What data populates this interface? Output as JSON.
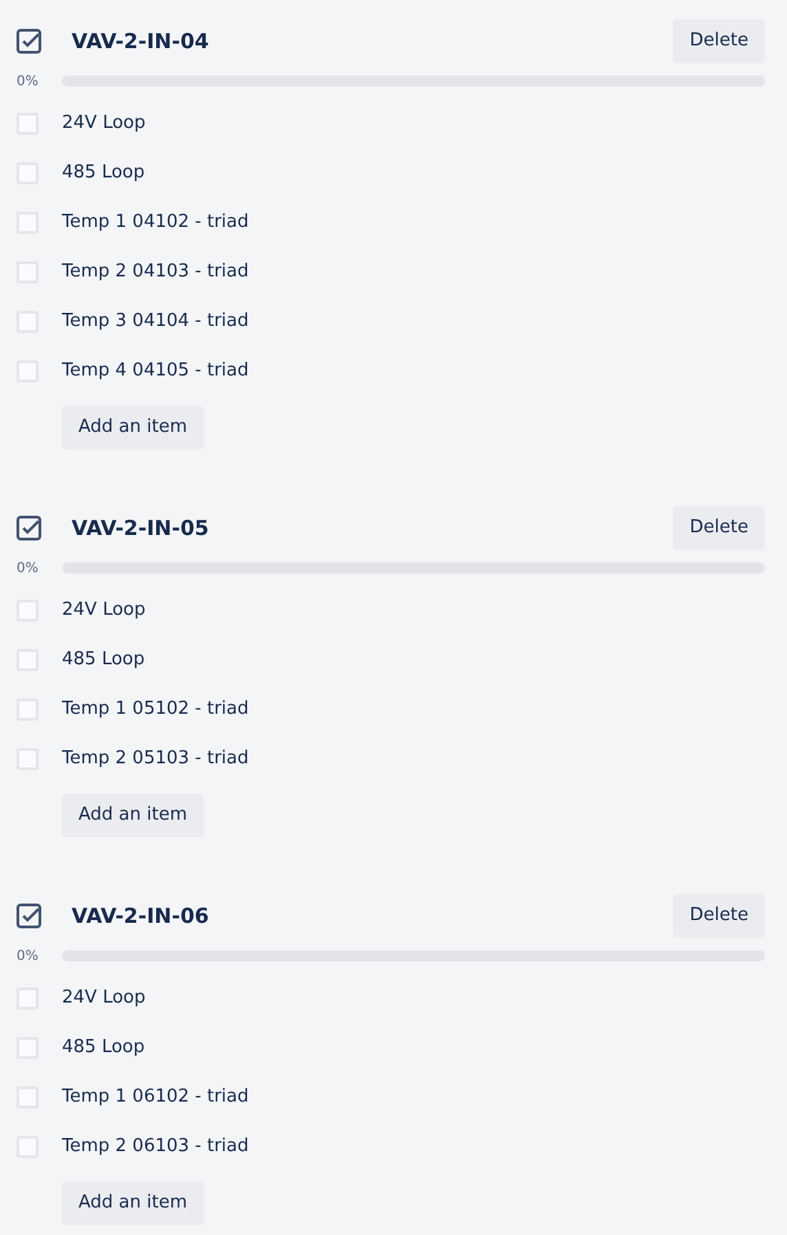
{
  "checklists": [
    {
      "title": "VAV-2-IN-04",
      "delete_label": "Delete",
      "progress_text": "0%",
      "level": 0,
      "add_label": "Add an item",
      "items": [
        {
          "text": "24V Loop",
          "checked": false
        },
        {
          "text": "485 Loop",
          "checked": false
        },
        {
          "text": "Temp 1 04102 - triad",
          "checked": false
        },
        {
          "text": "Temp 2 04103 - triad",
          "checked": false
        },
        {
          "text": "Temp 3 04104 - triad",
          "checked": false
        },
        {
          "text": "Temp 4 04105 - triad",
          "checked": false
        }
      ]
    },
    {
      "title": "VAV-2-IN-05",
      "delete_label": "Delete",
      "progress_text": "0%",
      "level": 0,
      "add_label": "Add an item",
      "items": [
        {
          "text": "24V Loop",
          "checked": false
        },
        {
          "text": "485 Loop",
          "checked": false
        },
        {
          "text": "Temp 1 05102 - triad",
          "checked": false
        },
        {
          "text": "Temp 2 05103 - triad",
          "checked": false
        }
      ]
    },
    {
      "title": "VAV-2-IN-06",
      "delete_label": "Delete",
      "progress_text": "0%",
      "level": 0,
      "add_label": "Add an item",
      "items": [
        {
          "text": "24V Loop",
          "checked": false
        },
        {
          "text": "485 Loop",
          "checked": false
        },
        {
          "text": "Temp 1 06102 - triad",
          "checked": false
        },
        {
          "text": "Temp 2 06103 - triad",
          "checked": false
        }
      ]
    }
  ]
}
